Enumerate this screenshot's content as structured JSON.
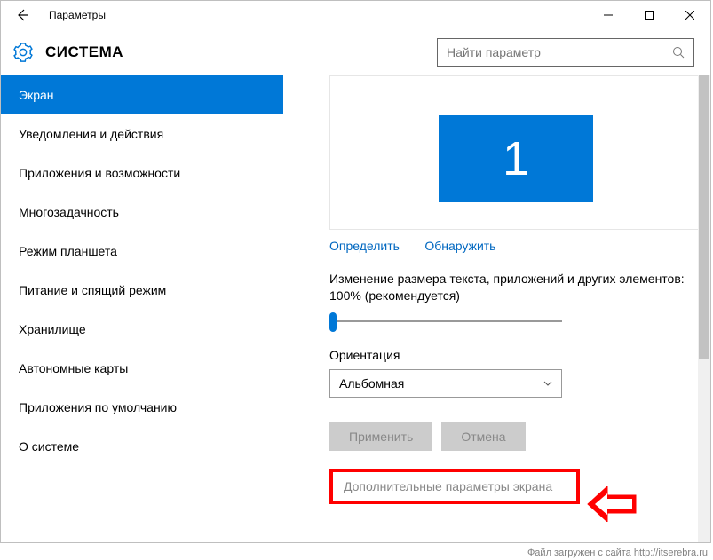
{
  "titlebar": {
    "title": "Параметры"
  },
  "header": {
    "title": "СИСТЕМА",
    "search_placeholder": "Найти параметр"
  },
  "sidebar": {
    "items": [
      {
        "label": "Экран",
        "active": true
      },
      {
        "label": "Уведомления и действия"
      },
      {
        "label": "Приложения и возможности"
      },
      {
        "label": "Многозадачность"
      },
      {
        "label": "Режим планшета"
      },
      {
        "label": "Питание и спящий режим"
      },
      {
        "label": "Хранилище"
      },
      {
        "label": "Автономные карты"
      },
      {
        "label": "Приложения по умолчанию"
      },
      {
        "label": "О системе"
      }
    ]
  },
  "content": {
    "monitor_number": "1",
    "link_identify": "Определить",
    "link_detect": "Обнаружить",
    "scale_label": "Изменение размера текста, приложений и других элементов: 100% (рекомендуется)",
    "orientation_label": "Ориентация",
    "orientation_value": "Альбомная",
    "btn_apply": "Применить",
    "btn_cancel": "Отмена",
    "advanced_link": "Дополнительные параметры экрана"
  },
  "footer": {
    "credit": "Файл загружен с сайта http://itserebra.ru"
  }
}
